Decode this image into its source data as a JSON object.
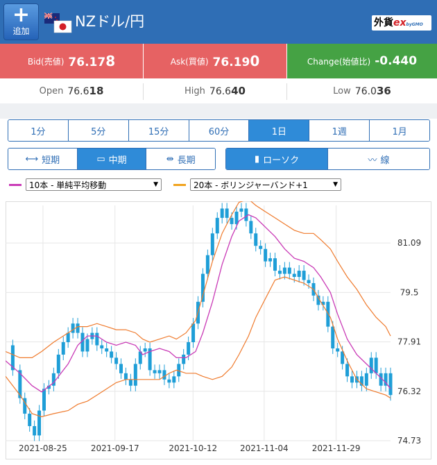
{
  "header": {
    "add_label": "追加",
    "pair_title": "NZドル/円",
    "logo_text": "外貨",
    "logo_ex": "ex",
    "logo_sub": "byGMO"
  },
  "quote": {
    "bid_label": "Bid(売値)",
    "bid_main": "76.17",
    "bid_last": "8",
    "ask_label": "Ask(買値)",
    "ask_main": "76.19",
    "ask_last": "0",
    "change_label": "Change(始値比)",
    "change_value": "-0.440"
  },
  "ohl": {
    "open_label": "Open",
    "open_main": "76.6",
    "open_last": "18",
    "high_label": "High",
    "high_main": "76.6",
    "high_last": "40",
    "low_label": "Low",
    "low_main": "76.0",
    "low_last": "36"
  },
  "periods": [
    "1分",
    "5分",
    "15分",
    "60分",
    "1日",
    "1週",
    "1月"
  ],
  "active_period": "1日",
  "spans": {
    "short": "短期",
    "mid": "中期",
    "long": "長期"
  },
  "chart_types": {
    "candle": "ローソク",
    "line": "線"
  },
  "indicators": {
    "sma_label": "10本 - 単純平均移動",
    "bb_label": "20本 - ボリンジャーバンド+1",
    "sma_color": "#c93ab6",
    "bb_color": "#f0a21c"
  },
  "colors": {
    "header": "#2f6eb5",
    "bid_ask": "#e66263",
    "change": "#45a244",
    "active_tab": "#2f8bd8",
    "candle": "#1e9ed7",
    "sma_line": "#c93ab6",
    "bb_line": "#ef7a2c"
  },
  "chart_data": {
    "type": "line",
    "ylim": [
      74.73,
      82.3
    ],
    "yticks": [
      "81.09",
      "79.5",
      "77.91",
      "76.32",
      "74.73"
    ],
    "xticks": [
      "2021-08-25",
      "2021-09-17",
      "2021-10-12",
      "2021-11-04",
      "2021-11-29"
    ],
    "grid": true,
    "series": [
      {
        "name": "10本 - 単純平均移動",
        "points": [
          [
            0,
            77.3
          ],
          [
            6,
            76.9
          ],
          [
            11,
            76.5
          ],
          [
            15,
            76.3
          ],
          [
            20,
            76.6
          ],
          [
            26,
            77.2
          ],
          [
            30,
            77.8
          ],
          [
            34,
            78.1
          ],
          [
            38,
            78.1
          ],
          [
            42,
            77.9
          ],
          [
            46,
            77.8
          ],
          [
            50,
            77.9
          ],
          [
            54,
            77.8
          ],
          [
            57,
            77.5
          ],
          [
            60,
            77.6
          ],
          [
            64,
            77.7
          ],
          [
            68,
            77.6
          ],
          [
            71,
            77.4
          ],
          [
            75,
            77.4
          ],
          [
            79,
            77.6
          ],
          [
            82,
            78.2
          ],
          [
            86,
            79.2
          ],
          [
            90,
            80.4
          ],
          [
            94,
            81.3
          ],
          [
            97,
            81.8
          ],
          [
            101,
            82.0
          ],
          [
            104,
            81.9
          ],
          [
            108,
            81.6
          ],
          [
            112,
            81.3
          ],
          [
            116,
            80.9
          ],
          [
            120,
            80.6
          ],
          [
            124,
            80.5
          ],
          [
            128,
            80.3
          ],
          [
            131,
            80.0
          ],
          [
            135,
            79.5
          ],
          [
            138,
            78.8
          ],
          [
            142,
            78.0
          ],
          [
            146,
            77.5
          ],
          [
            150,
            77.2
          ],
          [
            154,
            76.9
          ],
          [
            158,
            76.6
          ],
          [
            160,
            76.4
          ]
        ]
      },
      {
        "name": "20本 - ボリンジャーバンド+1",
        "points": [
          [
            0,
            77.6
          ],
          [
            6,
            77.4
          ],
          [
            11,
            77.4
          ],
          [
            15,
            77.6
          ],
          [
            20,
            77.9
          ],
          [
            26,
            78.2
          ],
          [
            30,
            78.4
          ],
          [
            34,
            78.4
          ],
          [
            38,
            78.5
          ],
          [
            42,
            78.4
          ],
          [
            46,
            78.3
          ],
          [
            50,
            78.3
          ],
          [
            54,
            78.2
          ],
          [
            57,
            78.0
          ],
          [
            60,
            77.9
          ],
          [
            64,
            78.0
          ],
          [
            68,
            78.1
          ],
          [
            71,
            78.0
          ],
          [
            75,
            78.2
          ],
          [
            79,
            78.6
          ],
          [
            82,
            79.4
          ],
          [
            86,
            80.5
          ],
          [
            90,
            81.4
          ],
          [
            94,
            82.0
          ],
          [
            97,
            82.4
          ],
          [
            101,
            82.5
          ],
          [
            104,
            82.3
          ],
          [
            108,
            82.1
          ],
          [
            112,
            81.9
          ],
          [
            116,
            81.7
          ],
          [
            120,
            81.5
          ],
          [
            124,
            81.4
          ],
          [
            128,
            81.4
          ],
          [
            131,
            81.2
          ],
          [
            135,
            80.9
          ],
          [
            138,
            80.5
          ],
          [
            142,
            80.0
          ],
          [
            146,
            79.6
          ],
          [
            150,
            79.1
          ],
          [
            154,
            78.7
          ],
          [
            158,
            78.4
          ],
          [
            160,
            78.1
          ]
        ]
      },
      {
        "name": "20本 - ボリンジャーバンド-1",
        "points": [
          [
            0,
            76.8
          ],
          [
            6,
            76.2
          ],
          [
            11,
            75.6
          ],
          [
            15,
            75.5
          ],
          [
            20,
            75.6
          ],
          [
            26,
            75.7
          ],
          [
            30,
            75.9
          ],
          [
            34,
            76.0
          ],
          [
            38,
            76.2
          ],
          [
            42,
            76.4
          ],
          [
            46,
            76.6
          ],
          [
            50,
            76.7
          ],
          [
            54,
            76.7
          ],
          [
            57,
            76.7
          ],
          [
            60,
            76.7
          ],
          [
            64,
            76.7
          ],
          [
            68,
            76.9
          ],
          [
            71,
            77.0
          ],
          [
            75,
            76.9
          ],
          [
            79,
            76.9
          ],
          [
            82,
            76.8
          ],
          [
            86,
            76.7
          ],
          [
            90,
            76.8
          ],
          [
            94,
            77.1
          ],
          [
            97,
            77.5
          ],
          [
            101,
            78.1
          ],
          [
            104,
            78.7
          ],
          [
            108,
            79.3
          ],
          [
            112,
            79.9
          ],
          [
            116,
            80.0
          ],
          [
            120,
            79.9
          ],
          [
            124,
            79.8
          ],
          [
            128,
            79.6
          ],
          [
            131,
            79.2
          ],
          [
            135,
            78.7
          ],
          [
            138,
            78.0
          ],
          [
            142,
            77.3
          ],
          [
            146,
            76.7
          ],
          [
            150,
            76.4
          ],
          [
            154,
            76.3
          ],
          [
            158,
            76.2
          ],
          [
            160,
            76.1
          ]
        ]
      },
      {
        "name": "close",
        "points": [
          [
            0,
            77.8
          ],
          [
            3,
            77.0
          ],
          [
            6,
            76.1
          ],
          [
            8,
            75.6
          ],
          [
            10,
            75.2
          ],
          [
            12,
            74.9
          ],
          [
            14,
            75.7
          ],
          [
            16,
            76.4
          ],
          [
            18,
            76.5
          ],
          [
            20,
            76.9
          ],
          [
            22,
            77.5
          ],
          [
            24,
            77.9
          ],
          [
            26,
            78.2
          ],
          [
            28,
            78.5
          ],
          [
            30,
            78.2
          ],
          [
            32,
            77.6
          ],
          [
            34,
            78.0
          ],
          [
            36,
            78.2
          ],
          [
            38,
            77.8
          ],
          [
            40,
            77.7
          ],
          [
            42,
            77.6
          ],
          [
            44,
            77.4
          ],
          [
            46,
            77.2
          ],
          [
            48,
            76.9
          ],
          [
            50,
            76.7
          ],
          [
            52,
            76.5
          ],
          [
            54,
            77.2
          ],
          [
            56,
            77.6
          ],
          [
            58,
            77.7
          ],
          [
            60,
            77.0
          ],
          [
            62,
            76.9
          ],
          [
            64,
            77.0
          ],
          [
            66,
            76.7
          ],
          [
            68,
            76.6
          ],
          [
            70,
            76.8
          ],
          [
            72,
            77.2
          ],
          [
            74,
            77.5
          ],
          [
            76,
            77.9
          ],
          [
            78,
            78.5
          ],
          [
            80,
            79.2
          ],
          [
            82,
            80.1
          ],
          [
            84,
            80.7
          ],
          [
            86,
            81.4
          ],
          [
            88,
            81.9
          ],
          [
            90,
            82.2
          ],
          [
            92,
            81.9
          ],
          [
            94,
            81.7
          ],
          [
            96,
            82.1
          ],
          [
            98,
            82.2
          ],
          [
            100,
            81.8
          ],
          [
            102,
            81.4
          ],
          [
            104,
            81.0
          ],
          [
            106,
            80.9
          ],
          [
            108,
            80.5
          ],
          [
            110,
            80.6
          ],
          [
            112,
            80.2
          ],
          [
            114,
            80.1
          ],
          [
            116,
            80.3
          ],
          [
            118,
            80.1
          ],
          [
            120,
            80.0
          ],
          [
            122,
            80.2
          ],
          [
            124,
            79.9
          ],
          [
            126,
            79.8
          ],
          [
            128,
            79.4
          ],
          [
            130,
            79.1
          ],
          [
            132,
            79.2
          ],
          [
            134,
            78.4
          ],
          [
            136,
            77.7
          ],
          [
            138,
            77.6
          ],
          [
            140,
            77.2
          ],
          [
            142,
            76.8
          ],
          [
            144,
            76.6
          ],
          [
            146,
            76.8
          ],
          [
            148,
            76.5
          ],
          [
            150,
            76.9
          ],
          [
            152,
            77.4
          ],
          [
            154,
            76.9
          ],
          [
            156,
            76.5
          ],
          [
            158,
            76.9
          ],
          [
            160,
            76.2
          ]
        ]
      }
    ]
  }
}
